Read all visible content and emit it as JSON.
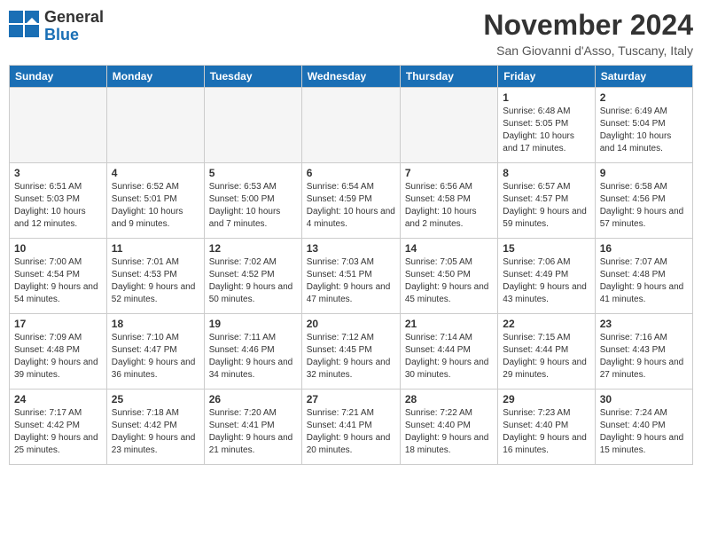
{
  "logo": {
    "general": "General",
    "blue": "Blue"
  },
  "title": "November 2024",
  "location": "San Giovanni d'Asso, Tuscany, Italy",
  "headers": [
    "Sunday",
    "Monday",
    "Tuesday",
    "Wednesday",
    "Thursday",
    "Friday",
    "Saturday"
  ],
  "weeks": [
    [
      {
        "day": "",
        "info": "",
        "empty": true
      },
      {
        "day": "",
        "info": "",
        "empty": true
      },
      {
        "day": "",
        "info": "",
        "empty": true
      },
      {
        "day": "",
        "info": "",
        "empty": true
      },
      {
        "day": "",
        "info": "",
        "empty": true
      },
      {
        "day": "1",
        "info": "Sunrise: 6:48 AM\nSunset: 5:05 PM\nDaylight: 10 hours and 17 minutes."
      },
      {
        "day": "2",
        "info": "Sunrise: 6:49 AM\nSunset: 5:04 PM\nDaylight: 10 hours and 14 minutes."
      }
    ],
    [
      {
        "day": "3",
        "info": "Sunrise: 6:51 AM\nSunset: 5:03 PM\nDaylight: 10 hours and 12 minutes."
      },
      {
        "day": "4",
        "info": "Sunrise: 6:52 AM\nSunset: 5:01 PM\nDaylight: 10 hours and 9 minutes."
      },
      {
        "day": "5",
        "info": "Sunrise: 6:53 AM\nSunset: 5:00 PM\nDaylight: 10 hours and 7 minutes."
      },
      {
        "day": "6",
        "info": "Sunrise: 6:54 AM\nSunset: 4:59 PM\nDaylight: 10 hours and 4 minutes."
      },
      {
        "day": "7",
        "info": "Sunrise: 6:56 AM\nSunset: 4:58 PM\nDaylight: 10 hours and 2 minutes."
      },
      {
        "day": "8",
        "info": "Sunrise: 6:57 AM\nSunset: 4:57 PM\nDaylight: 9 hours and 59 minutes."
      },
      {
        "day": "9",
        "info": "Sunrise: 6:58 AM\nSunset: 4:56 PM\nDaylight: 9 hours and 57 minutes."
      }
    ],
    [
      {
        "day": "10",
        "info": "Sunrise: 7:00 AM\nSunset: 4:54 PM\nDaylight: 9 hours and 54 minutes."
      },
      {
        "day": "11",
        "info": "Sunrise: 7:01 AM\nSunset: 4:53 PM\nDaylight: 9 hours and 52 minutes."
      },
      {
        "day": "12",
        "info": "Sunrise: 7:02 AM\nSunset: 4:52 PM\nDaylight: 9 hours and 50 minutes."
      },
      {
        "day": "13",
        "info": "Sunrise: 7:03 AM\nSunset: 4:51 PM\nDaylight: 9 hours and 47 minutes."
      },
      {
        "day": "14",
        "info": "Sunrise: 7:05 AM\nSunset: 4:50 PM\nDaylight: 9 hours and 45 minutes."
      },
      {
        "day": "15",
        "info": "Sunrise: 7:06 AM\nSunset: 4:49 PM\nDaylight: 9 hours and 43 minutes."
      },
      {
        "day": "16",
        "info": "Sunrise: 7:07 AM\nSunset: 4:48 PM\nDaylight: 9 hours and 41 minutes."
      }
    ],
    [
      {
        "day": "17",
        "info": "Sunrise: 7:09 AM\nSunset: 4:48 PM\nDaylight: 9 hours and 39 minutes."
      },
      {
        "day": "18",
        "info": "Sunrise: 7:10 AM\nSunset: 4:47 PM\nDaylight: 9 hours and 36 minutes."
      },
      {
        "day": "19",
        "info": "Sunrise: 7:11 AM\nSunset: 4:46 PM\nDaylight: 9 hours and 34 minutes."
      },
      {
        "day": "20",
        "info": "Sunrise: 7:12 AM\nSunset: 4:45 PM\nDaylight: 9 hours and 32 minutes."
      },
      {
        "day": "21",
        "info": "Sunrise: 7:14 AM\nSunset: 4:44 PM\nDaylight: 9 hours and 30 minutes."
      },
      {
        "day": "22",
        "info": "Sunrise: 7:15 AM\nSunset: 4:44 PM\nDaylight: 9 hours and 29 minutes."
      },
      {
        "day": "23",
        "info": "Sunrise: 7:16 AM\nSunset: 4:43 PM\nDaylight: 9 hours and 27 minutes."
      }
    ],
    [
      {
        "day": "24",
        "info": "Sunrise: 7:17 AM\nSunset: 4:42 PM\nDaylight: 9 hours and 25 minutes."
      },
      {
        "day": "25",
        "info": "Sunrise: 7:18 AM\nSunset: 4:42 PM\nDaylight: 9 hours and 23 minutes."
      },
      {
        "day": "26",
        "info": "Sunrise: 7:20 AM\nSunset: 4:41 PM\nDaylight: 9 hours and 21 minutes."
      },
      {
        "day": "27",
        "info": "Sunrise: 7:21 AM\nSunset: 4:41 PM\nDaylight: 9 hours and 20 minutes."
      },
      {
        "day": "28",
        "info": "Sunrise: 7:22 AM\nSunset: 4:40 PM\nDaylight: 9 hours and 18 minutes."
      },
      {
        "day": "29",
        "info": "Sunrise: 7:23 AM\nSunset: 4:40 PM\nDaylight: 9 hours and 16 minutes."
      },
      {
        "day": "30",
        "info": "Sunrise: 7:24 AM\nSunset: 4:40 PM\nDaylight: 9 hours and 15 minutes."
      }
    ]
  ]
}
